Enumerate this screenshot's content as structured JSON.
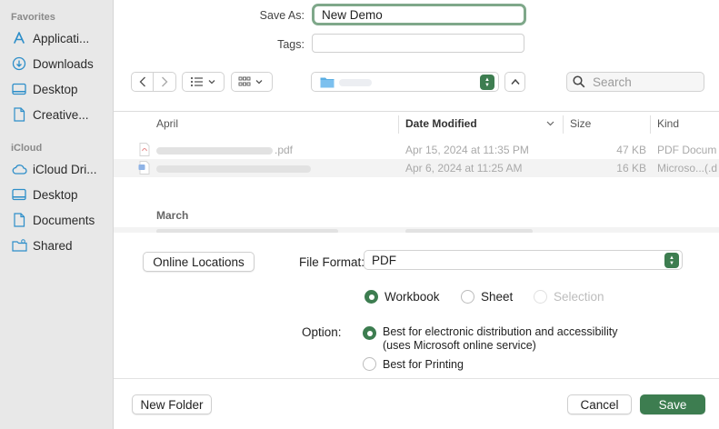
{
  "sidebar": {
    "favorites_title": "Favorites",
    "favorites": [
      {
        "label": "Applicati...",
        "icon": "applications-icon"
      },
      {
        "label": "Downloads",
        "icon": "downloads-icon"
      },
      {
        "label": "Desktop",
        "icon": "desktop-icon"
      },
      {
        "label": "Creative...",
        "icon": "document-icon"
      }
    ],
    "icloud_title": "iCloud",
    "icloud": [
      {
        "label": "iCloud Dri...",
        "icon": "cloud-icon"
      },
      {
        "label": "Desktop",
        "icon": "desktop-icon"
      },
      {
        "label": "Documents",
        "icon": "document-icon"
      },
      {
        "label": "Shared",
        "icon": "shared-folder-icon"
      }
    ]
  },
  "save": {
    "save_as_label": "Save As:",
    "filename": "New Demo",
    "tags_label": "Tags:",
    "tags_value": ""
  },
  "toolbar": {
    "search_placeholder": "Search"
  },
  "list": {
    "columns": {
      "name": "April",
      "date": "Date Modified",
      "size": "Size",
      "kind": "Kind"
    },
    "files": [
      {
        "name_suffix": ".pdf",
        "date": "Apr 15, 2024 at 11:35 PM",
        "size": "47 KB",
        "kind": "PDF Docum",
        "icon": "pdf-file-icon"
      },
      {
        "name_suffix": "",
        "date": "Apr 6, 2024 at 11:25 AM",
        "size": "16 KB",
        "kind": "Microso...(.d",
        "icon": "word-file-icon"
      }
    ],
    "march_header": "March"
  },
  "options": {
    "online_locations": "Online Locations",
    "file_format_label": "File Format:",
    "file_format_value": "PDF",
    "scope": {
      "workbook": "Workbook",
      "sheet": "Sheet",
      "selection": "Selection"
    },
    "option_label": "Option:",
    "option_1_line1": "Best for electronic distribution and accessibility",
    "option_1_line2": "(uses Microsoft online service)",
    "option_2": "Best for Printing"
  },
  "bottom": {
    "new_folder": "New Folder",
    "cancel": "Cancel",
    "save": "Save"
  },
  "colors": {
    "accent": "#3d7d50",
    "focus_ring": "#7fa88a",
    "sidebar_bg": "#e8e8e8",
    "icon_blue": "#2d8ec9"
  }
}
